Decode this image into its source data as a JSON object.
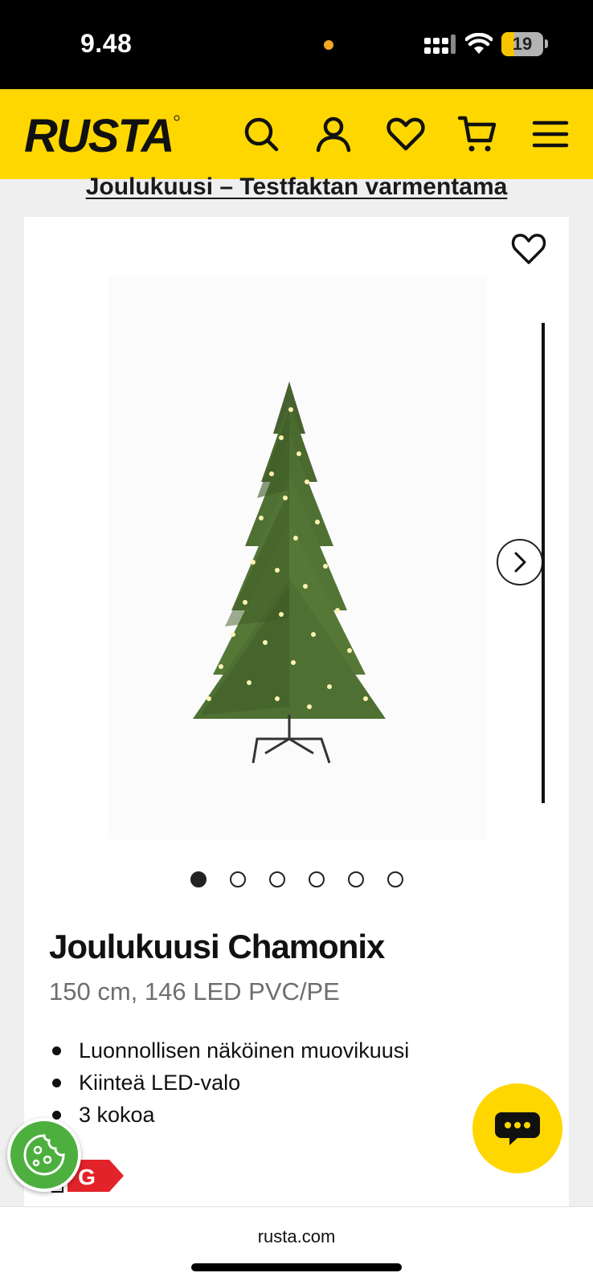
{
  "status_bar": {
    "time": "9.48",
    "battery": "19",
    "icons": [
      "signal-icon",
      "wifi-icon",
      "battery-icon"
    ]
  },
  "header": {
    "logo_text": "RUSTA",
    "brand_color": "#ffd700",
    "icons": [
      "search-icon",
      "account-icon",
      "heart-icon",
      "cart-icon",
      "menu-icon"
    ]
  },
  "page": {
    "scrolled_heading": "Joulukuusi – Testfaktan varmentama"
  },
  "product": {
    "title": "Joulukuusi Chamonix",
    "subtitle": "150 cm, 146 LED PVC/PE",
    "features": [
      "Luonnollisen näköinen muovikuusi",
      "Kiinteä LED-valo",
      "3 kokoa"
    ],
    "energy_class": "G",
    "gallery": {
      "count": 6,
      "active_index": 0
    }
  },
  "browser": {
    "url": "rusta.com"
  }
}
